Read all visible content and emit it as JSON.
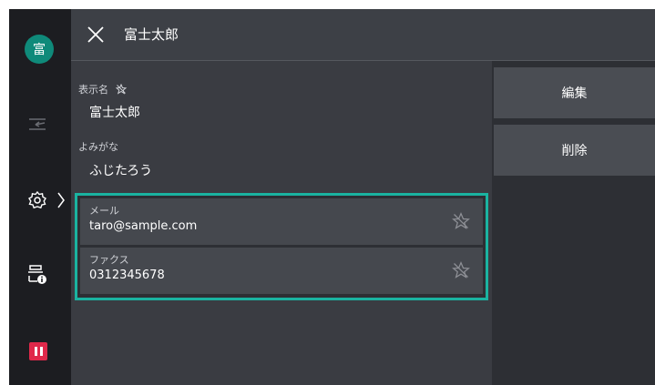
{
  "sidebar": {
    "avatar_initial": "富"
  },
  "header": {
    "title": "富士太郎"
  },
  "fields": {
    "display_name_label": "表示名",
    "display_name_value": "富士太郎",
    "reading_label": "よみがな",
    "reading_value": "ふじたろう"
  },
  "contacts": [
    {
      "label": "メール",
      "value": "taro@sample.com"
    },
    {
      "label": "ファクス",
      "value": "0312345678"
    }
  ],
  "actions": {
    "edit_label": "編集",
    "delete_label": "削除"
  },
  "colors": {
    "accent": "#1ab3a1",
    "avatar": "#0f8a7a",
    "pause": "#e0284a"
  },
  "icons": [
    "close-icon",
    "transfer-icon",
    "gear-icon",
    "chevron-right-icon",
    "printer-info-icon",
    "pause-icon",
    "star-outline-icon"
  ]
}
